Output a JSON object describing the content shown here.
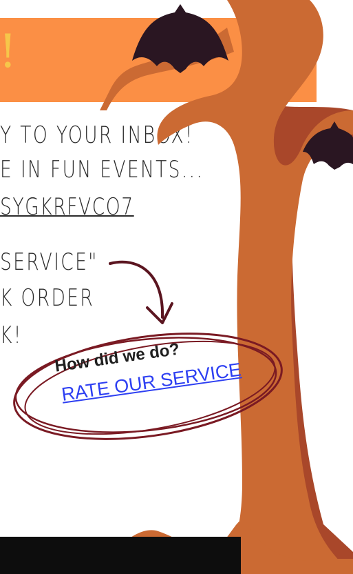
{
  "header": {
    "glyph": "!"
  },
  "body_lines": [
    "Y TO YOUR INBOX!",
    "E IN FUN EVENTS...",
    "SYGKRFVCO7",
    "SERVICE\"",
    "K ORDER",
    "K!"
  ],
  "rate_card": {
    "question": "How did we do?",
    "link_label": "RATE OUR SERVICE"
  },
  "colors": {
    "orange_band": "#fb8f45",
    "tree_light": "#cb6a33",
    "tree_dark": "#a9472a",
    "bat": "#2a1622",
    "circle": "#7a1a23",
    "link": "#2d3ff2"
  }
}
